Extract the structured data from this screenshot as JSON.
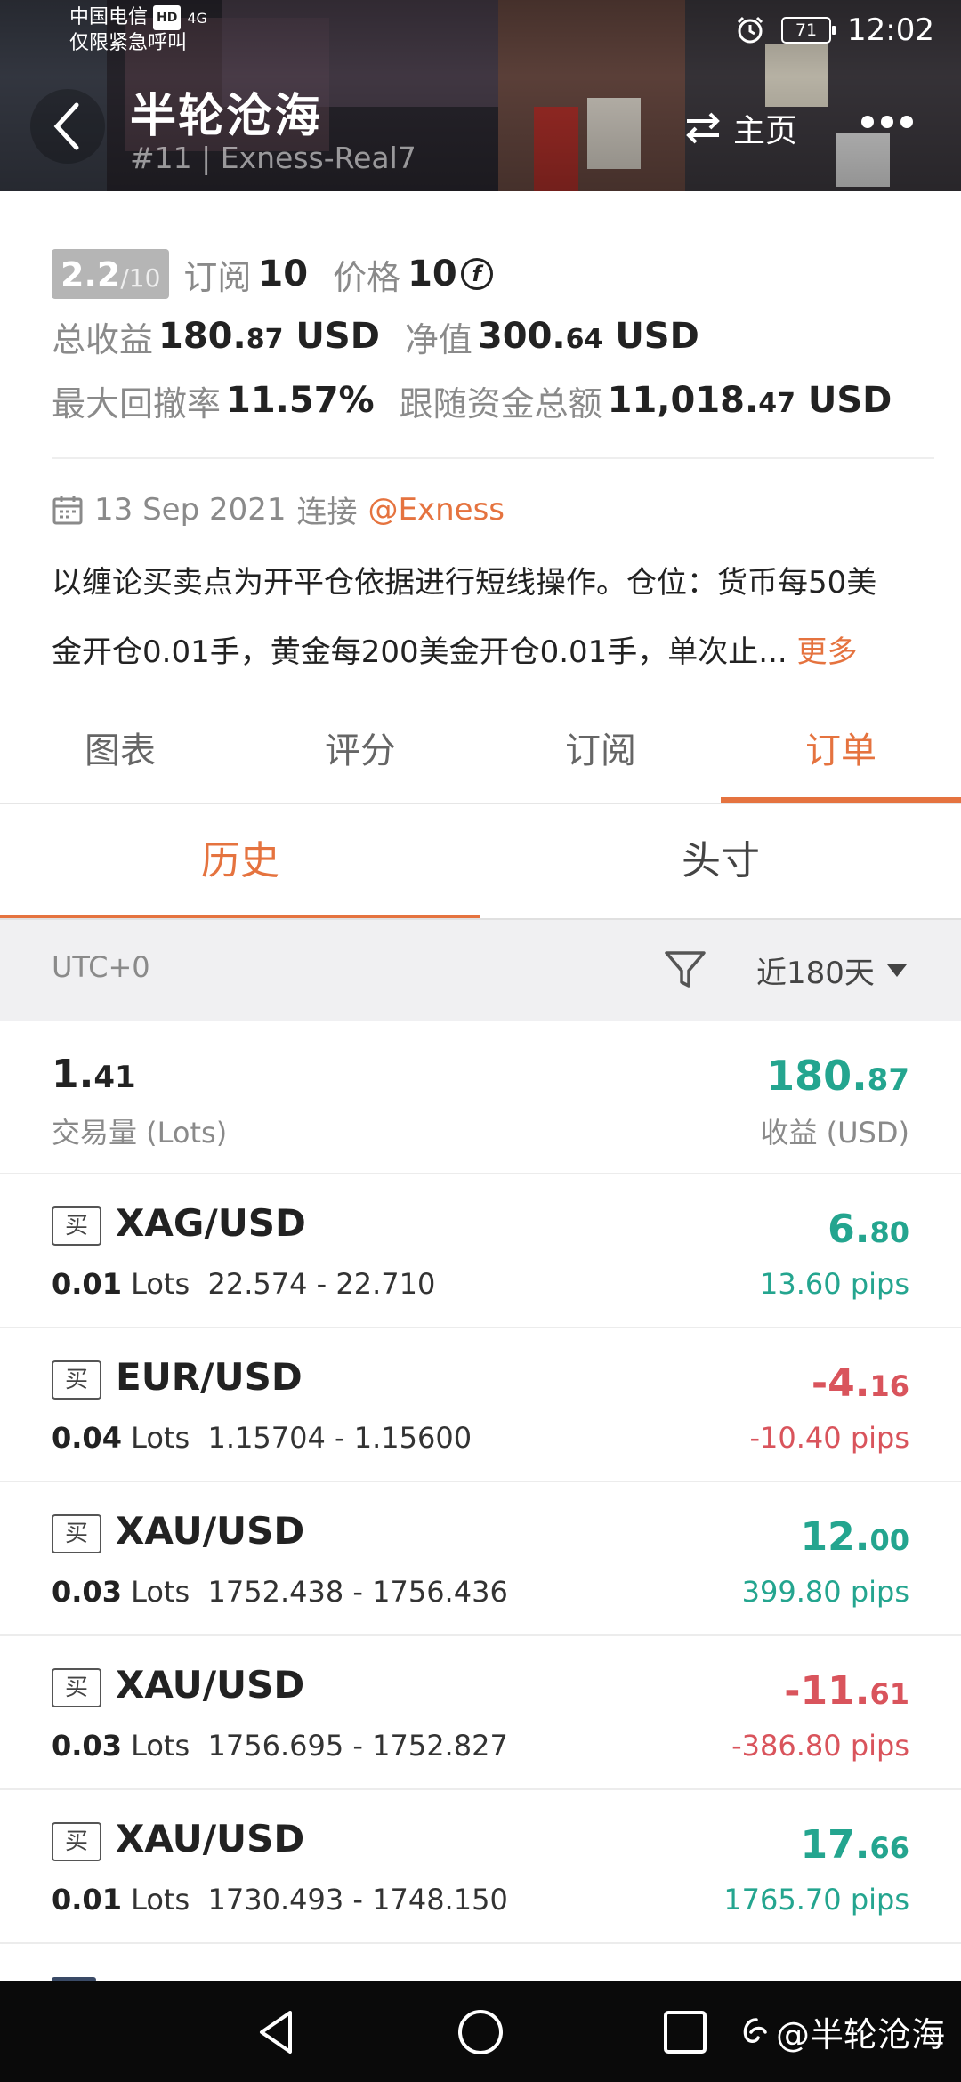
{
  "status_bar": {
    "carrier": "中国电信",
    "hd": "HD",
    "signal": "4G",
    "emergency": "仅限紧急呼叫",
    "battery": "71",
    "time": "12:02"
  },
  "header": {
    "title": "半轮沧海",
    "subtitle": "#11 | Exness-Real7",
    "home_label": "主页"
  },
  "stats": {
    "rating_main": "2.2",
    "rating_max": "/10",
    "subscribe_label": "订阅",
    "subscribe_value": "10",
    "price_label": "价格",
    "price_value": "10",
    "total_profit_label": "总收益",
    "total_profit_int": "180.",
    "total_profit_dec": "87",
    "total_profit_unit": "USD",
    "equity_label": "净值",
    "equity_int": "300.",
    "equity_dec": "64",
    "equity_unit": "USD",
    "drawdown_label": "最大回撤率",
    "drawdown_value": "11.57%",
    "follow_label": "跟随资金总额",
    "follow_int": "11,018.",
    "follow_dec": "47",
    "follow_unit": "USD"
  },
  "connection": {
    "date": "13 Sep 2021",
    "label": "连接",
    "broker": "@Exness"
  },
  "description": {
    "line1": "以缠论买卖点为开平仓依据进行短线操作。仓位：货币每50美",
    "line2": "金开仓0.01手，黄金每200美金开仓0.01手，单次止...",
    "more": "更多"
  },
  "tabs": [
    "图表",
    "评分",
    "订阅",
    "订单"
  ],
  "subtabs": [
    "历史",
    "头寸"
  ],
  "filter": {
    "timezone": "UTC+0",
    "range": "近180天"
  },
  "summary": {
    "volume_int": "1.",
    "volume_dec": "41",
    "volume_label": "交易量 (Lots)",
    "profit_int": "180.",
    "profit_dec": "87",
    "profit_label": "收益 (USD)"
  },
  "orders": [
    {
      "side": "买",
      "symbol": "XAG/USD",
      "lots": "0.01",
      "lots_unit": "Lots",
      "prices": "22.574 - 22.710",
      "pnl_int": "6.",
      "pnl_dec": "80",
      "pips": "13.60 pips",
      "sign": "pos"
    },
    {
      "side": "买",
      "symbol": "EUR/USD",
      "lots": "0.04",
      "lots_unit": "Lots",
      "prices": "1.15704 - 1.15600",
      "pnl_int": "-4.",
      "pnl_dec": "16",
      "pips": "-10.40 pips",
      "sign": "neg"
    },
    {
      "side": "买",
      "symbol": "XAU/USD",
      "lots": "0.03",
      "lots_unit": "Lots",
      "prices": "1752.438 - 1756.436",
      "pnl_int": "12.",
      "pnl_dec": "00",
      "pips": "399.80 pips",
      "sign": "pos"
    },
    {
      "side": "买",
      "symbol": "XAU/USD",
      "lots": "0.03",
      "lots_unit": "Lots",
      "prices": "1756.695 - 1752.827",
      "pnl_int": "-11.",
      "pnl_dec": "61",
      "pips": "-386.80 pips",
      "sign": "neg"
    },
    {
      "side": "买",
      "symbol": "XAU/USD",
      "lots": "0.01",
      "lots_unit": "Lots",
      "prices": "1730.493 - 1748.150",
      "pnl_int": "17.",
      "pnl_dec": "66",
      "pips": "1765.70 pips",
      "sign": "pos"
    }
  ],
  "watermark": "@半轮沧海",
  "colors": {
    "accent": "#e5733f",
    "profit": "#24a58f",
    "loss": "#d9545c"
  }
}
